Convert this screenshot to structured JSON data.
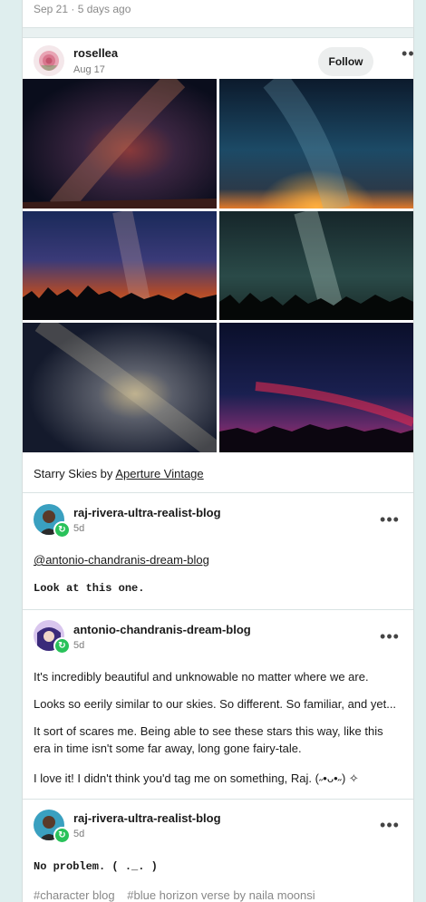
{
  "prev_post": {
    "date": "Sep 21 · 5 days ago"
  },
  "post": {
    "author": "rosellea",
    "date": "Aug 17",
    "follow_label": "Follow",
    "more_label": "•••",
    "caption_prefix": "Starry Skies by ",
    "caption_link": "Aperture Vintage",
    "images": [
      {
        "name": "milky-way-red-glow"
      },
      {
        "name": "milky-way-orange-horizon"
      },
      {
        "name": "milky-way-treeline-sunset"
      },
      {
        "name": "milky-way-green-treeline"
      },
      {
        "name": "milky-way-dense-stars"
      },
      {
        "name": "red-aurora-sky"
      }
    ]
  },
  "replies": [
    {
      "author": "raj-rivera-ultra-realist-blog",
      "time": "5d",
      "mention": "@antonio-chandranis-dream-blog",
      "text": "Look at this one."
    },
    {
      "author": "antonio-chandranis-dream-blog",
      "time": "5d",
      "paragraphs": [
        "It's incredibly beautiful and unknowable no matter where we are.",
        "Looks so eerily similar to our skies. So different. So familiar, and yet...",
        "It sort of scares me. Being able to see these stars this way, like this era in time isn't some far away, long gone fairy-tale.",
        "I love it! I didn't think you'd tag me on something, Raj. (˶•ᴗ•˶) ✧"
      ]
    },
    {
      "author": "raj-rivera-ultra-realist-blog",
      "time": "5d",
      "text": "No problem. (  ._. )"
    }
  ],
  "tags": [
    "#character blog",
    "#blue horizon verse by naila moonsi"
  ],
  "colors": {
    "reblog_badge": "#29c25a",
    "link": "#1a1a1a"
  }
}
